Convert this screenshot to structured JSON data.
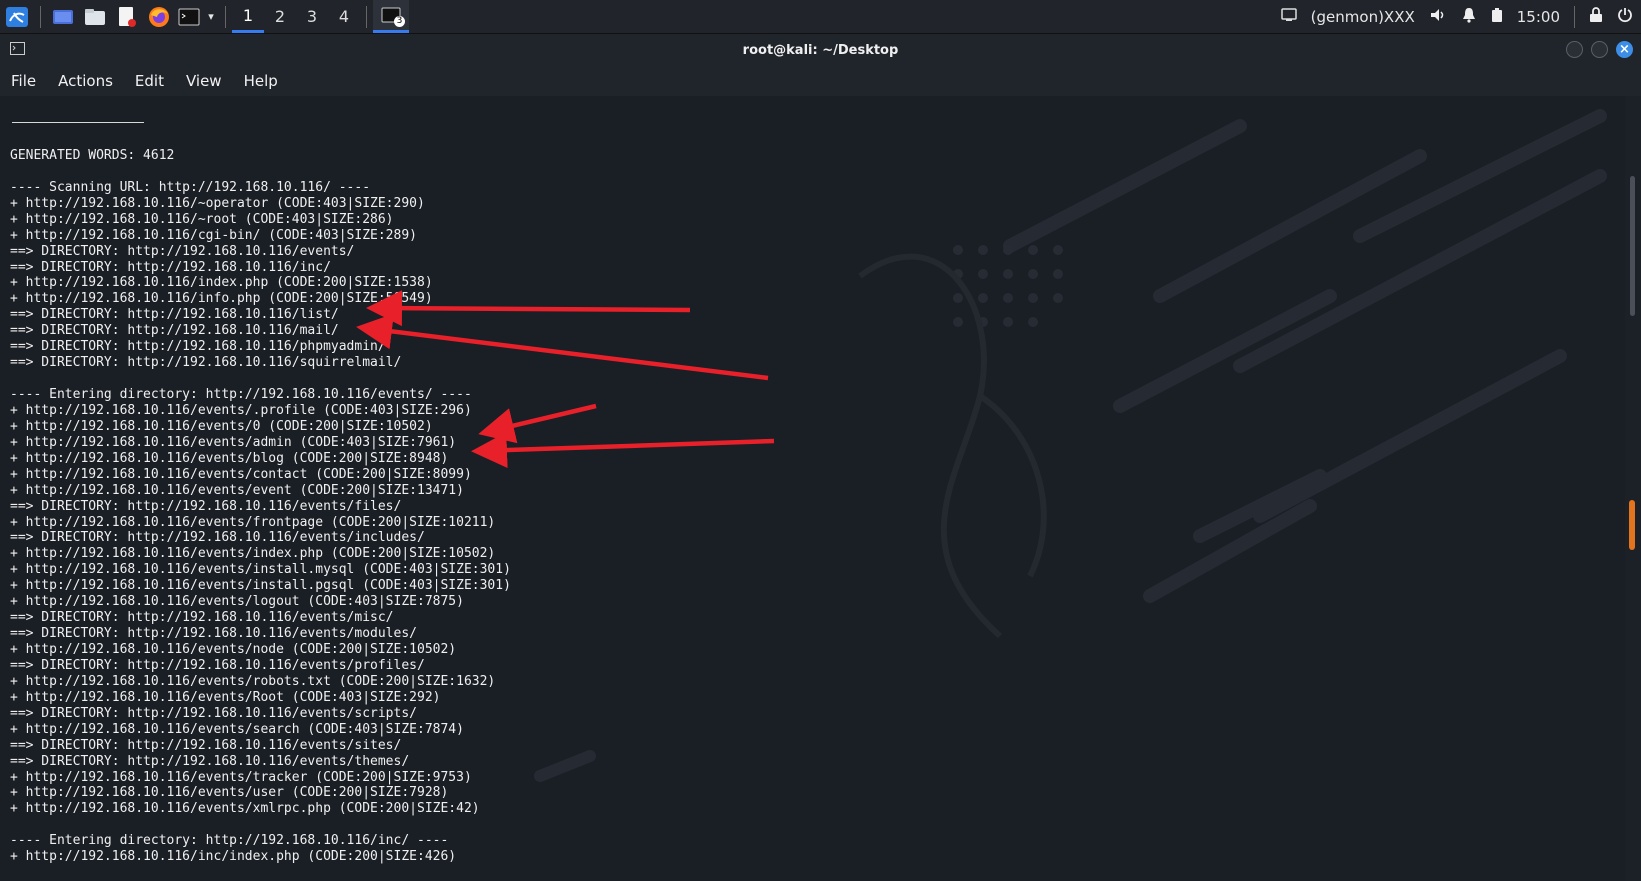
{
  "panel": {
    "workspaces": [
      "1",
      "2",
      "3",
      "4"
    ],
    "active_workspace": "1",
    "task_badge": "3",
    "genmon": "(genmon)XXX",
    "clock": "15:00"
  },
  "window": {
    "title": "root@kali: ~/Desktop"
  },
  "menu": {
    "items": [
      "File",
      "Actions",
      "Edit",
      "View",
      "Help"
    ]
  },
  "terminal": {
    "lines": [
      "",
      "GENERATED WORDS: 4612",
      "",
      "---- Scanning URL: http://192.168.10.116/ ----",
      "+ http://192.168.10.116/~operator (CODE:403|SIZE:290)",
      "+ http://192.168.10.116/~root (CODE:403|SIZE:286)",
      "+ http://192.168.10.116/cgi-bin/ (CODE:403|SIZE:289)",
      "==> DIRECTORY: http://192.168.10.116/events/",
      "==> DIRECTORY: http://192.168.10.116/inc/",
      "+ http://192.168.10.116/index.php (CODE:200|SIZE:1538)",
      "+ http://192.168.10.116/info.php (CODE:200|SIZE:50549)",
      "==> DIRECTORY: http://192.168.10.116/list/",
      "==> DIRECTORY: http://192.168.10.116/mail/",
      "==> DIRECTORY: http://192.168.10.116/phpmyadmin/",
      "==> DIRECTORY: http://192.168.10.116/squirrelmail/",
      "",
      "---- Entering directory: http://192.168.10.116/events/ ----",
      "+ http://192.168.10.116/events/.profile (CODE:403|SIZE:296)",
      "+ http://192.168.10.116/events/0 (CODE:200|SIZE:10502)",
      "+ http://192.168.10.116/events/admin (CODE:403|SIZE:7961)",
      "+ http://192.168.10.116/events/blog (CODE:200|SIZE:8948)",
      "+ http://192.168.10.116/events/contact (CODE:200|SIZE:8099)",
      "+ http://192.168.10.116/events/event (CODE:200|SIZE:13471)",
      "==> DIRECTORY: http://192.168.10.116/events/files/",
      "+ http://192.168.10.116/events/frontpage (CODE:200|SIZE:10211)",
      "==> DIRECTORY: http://192.168.10.116/events/includes/",
      "+ http://192.168.10.116/events/index.php (CODE:200|SIZE:10502)",
      "+ http://192.168.10.116/events/install.mysql (CODE:403|SIZE:301)",
      "+ http://192.168.10.116/events/install.pgsql (CODE:403|SIZE:301)",
      "+ http://192.168.10.116/events/logout (CODE:403|SIZE:7875)",
      "==> DIRECTORY: http://192.168.10.116/events/misc/",
      "==> DIRECTORY: http://192.168.10.116/events/modules/",
      "+ http://192.168.10.116/events/node (CODE:200|SIZE:10502)",
      "==> DIRECTORY: http://192.168.10.116/events/profiles/",
      "+ http://192.168.10.116/events/robots.txt (CODE:200|SIZE:1632)",
      "+ http://192.168.10.116/events/Root (CODE:403|SIZE:292)",
      "==> DIRECTORY: http://192.168.10.116/events/scripts/",
      "+ http://192.168.10.116/events/search (CODE:403|SIZE:7874)",
      "==> DIRECTORY: http://192.168.10.116/events/sites/",
      "==> DIRECTORY: http://192.168.10.116/events/themes/",
      "+ http://192.168.10.116/events/tracker (CODE:200|SIZE:9753)",
      "+ http://192.168.10.116/events/user (CODE:200|SIZE:7928)",
      "+ http://192.168.10.116/events/xmlrpc.php (CODE:200|SIZE:42)",
      "",
      "---- Entering directory: http://192.168.10.116/inc/ ----",
      "+ http://192.168.10.116/inc/index.php (CODE:200|SIZE:426)"
    ]
  },
  "colors": {
    "accent": "#367bf0",
    "arrow": "#e8202a",
    "scroll_marker": "#e2731f"
  },
  "icons": [
    "kali-menu-icon",
    "desktop-icon",
    "file-manager-icon",
    "text-editor-icon",
    "firefox-icon",
    "terminal-icon",
    "chevron-down-icon",
    "display-icon",
    "volume-icon",
    "bell-icon",
    "battery-icon",
    "lock-icon",
    "power-icon"
  ]
}
